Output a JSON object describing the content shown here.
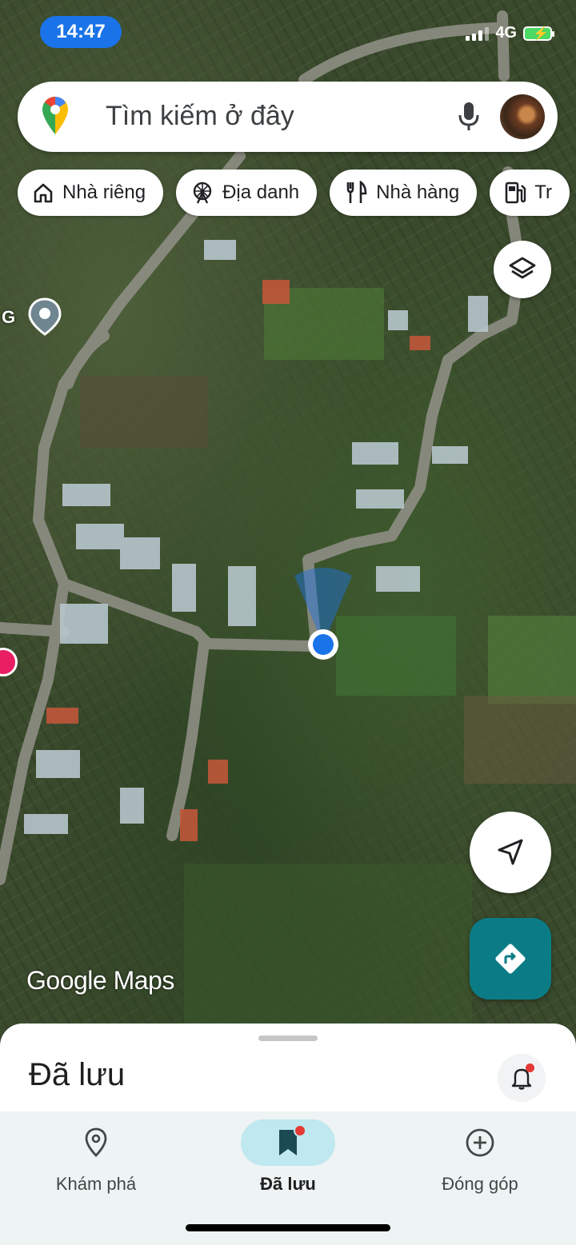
{
  "status_bar": {
    "time": "14:47",
    "network": "4G",
    "icons": [
      "signal-bars-icon",
      "battery-charging-icon"
    ]
  },
  "search": {
    "placeholder": "Tìm kiếm ở đây",
    "icons": [
      "google-maps-pin-icon",
      "microphone-icon",
      "profile-avatar"
    ]
  },
  "chips": [
    {
      "label": "Nhà riêng",
      "icon": "home-icon"
    },
    {
      "label": "Địa danh",
      "icon": "ferris-wheel-icon"
    },
    {
      "label": "Nhà hàng",
      "icon": "fork-knife-icon"
    },
    {
      "label": "Tr",
      "icon": "gas-station-icon"
    }
  ],
  "map": {
    "type": "satellite",
    "watermark": "Google Maps",
    "poi_label": "G",
    "buttons": [
      "layers-icon",
      "navigation-arrow-icon",
      "directions-icon"
    ],
    "colors": {
      "blue_dot": "#1a73e8",
      "directions_button": "#0b7c86"
    }
  },
  "sheet": {
    "title": "Đã lưu"
  },
  "bottom_nav": {
    "items": [
      {
        "label": "Khám phá",
        "icon": "explore-pin-icon",
        "active": false
      },
      {
        "label": "Đã lưu",
        "icon": "bookmark-icon",
        "active": true
      },
      {
        "label": "Đóng góp",
        "icon": "add-circle-icon",
        "active": false
      }
    ]
  }
}
